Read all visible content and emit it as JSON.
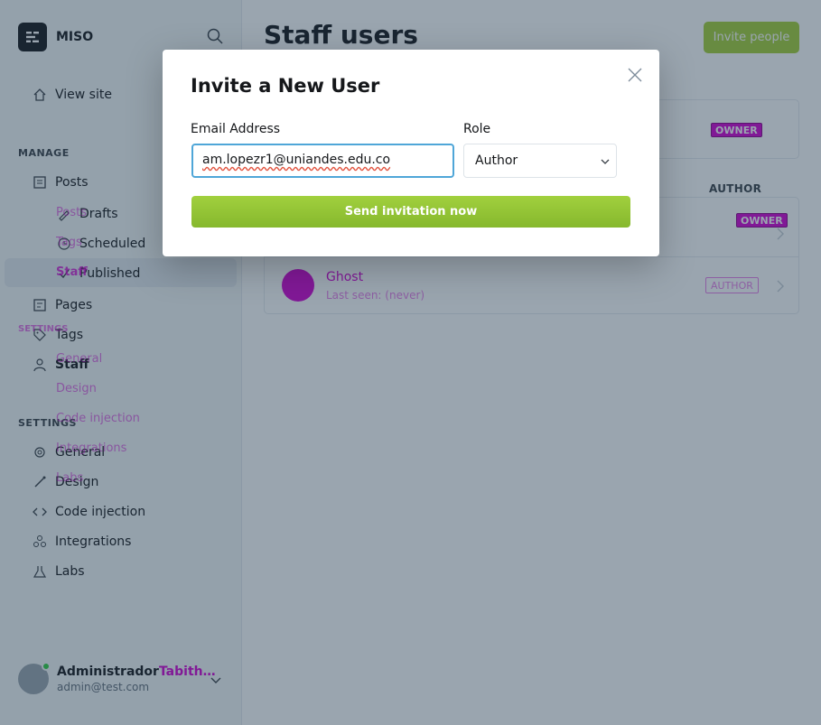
{
  "sidebar": {
    "brand_name": "MISO",
    "view_site": "View site",
    "manage_label": "MANAGE",
    "manage_items": [
      {
        "label": "Posts",
        "icon": "posts-icon"
      },
      {
        "label": "Drafts",
        "icon": "drafts-icon"
      },
      {
        "label": "Scheduled",
        "icon": "scheduled-icon"
      },
      {
        "label": "Published",
        "icon": "published-icon"
      },
      {
        "label": "Pages",
        "icon": "pages-icon"
      },
      {
        "label": "Tags",
        "icon": "tags-icon"
      },
      {
        "label": "Staff",
        "icon": "staff-icon"
      }
    ],
    "settings_label": "SETTINGS",
    "settings_items": [
      {
        "label": "General",
        "icon": "general-icon"
      },
      {
        "label": "Design",
        "icon": "design-icon"
      },
      {
        "label": "Code injection",
        "icon": "code-icon"
      },
      {
        "label": "Integrations",
        "icon": "integrations-icon"
      },
      {
        "label": "Labs",
        "icon": "labs-icon"
      }
    ],
    "overlay_texts": {
      "posts": "Posts",
      "tags": "Tags",
      "staff": "Staff",
      "settings": "SETTINGS",
      "general": "General",
      "design": "Design",
      "code_injection": "Code injection",
      "integrations": "Integrations",
      "labs": "Labs"
    },
    "user": {
      "name": "Administrador",
      "name_overlay": "Tabith…",
      "email": "admin@test.com"
    }
  },
  "main": {
    "title": "Staff users",
    "invite_button": "Invite people",
    "owner_badge": "OWNER",
    "author_header": "AUTHOR",
    "overlay_owner_badge": "OWNER",
    "ghost_user": {
      "name": "Ghost",
      "last_seen": "Last seen: (never)",
      "role": "AUTHOR"
    }
  },
  "modal": {
    "title": "Invite a New User",
    "email_label": "Email Address",
    "email_value": "am.lopezr1@uniandes.edu.co",
    "role_label": "Role",
    "role_value": "Author",
    "send_button": "Send invitation now"
  },
  "colors": {
    "accent_green": "#a4d037",
    "focus_blue": "#4fa6d8",
    "debug_magenta": "#d100d1",
    "overlay": "rgba(30,56,78,0.45)"
  }
}
